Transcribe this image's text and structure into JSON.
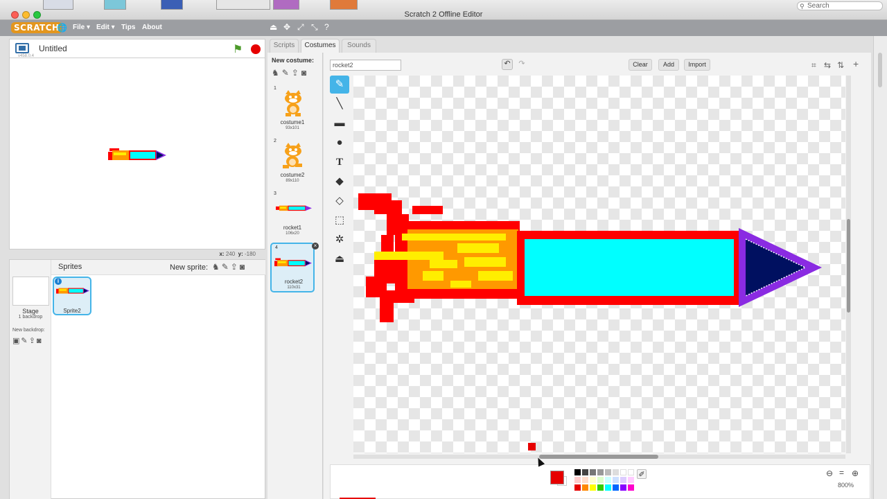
{
  "window": {
    "title": "Scratch 2 Offline Editor"
  },
  "mac": {
    "search_placeholder": "Search"
  },
  "menubar": {
    "logo": "SCRATCH",
    "file": "File ▾",
    "edit": "Edit ▾",
    "tips": "Tips",
    "about": "About"
  },
  "stage": {
    "title": "Untitled",
    "version": "v458.0.4",
    "coord_x_label": "x:",
    "coord_x": "240",
    "coord_y_label": "y:",
    "coord_y": "-180"
  },
  "sprites_panel": {
    "title": "Sprites",
    "new_sprite_label": "New sprite:",
    "stage_label": "Stage",
    "stage_sub": "1 backdrop",
    "new_backdrop_label": "New backdrop:",
    "sprites": [
      {
        "name": "Sprite2"
      }
    ]
  },
  "tabs": [
    {
      "label": "Scripts"
    },
    {
      "label": "Costumes"
    },
    {
      "label": "Sounds"
    }
  ],
  "costumes": {
    "new_costume_label": "New costume:",
    "items": [
      {
        "num": "1",
        "name": "costume1",
        "size": "93x101"
      },
      {
        "num": "2",
        "name": "costume2",
        "size": "89x110"
      },
      {
        "num": "3",
        "name": "rocket1",
        "size": "106x20"
      },
      {
        "num": "4",
        "name": "rocket2",
        "size": "110x31"
      }
    ]
  },
  "paint_editor": {
    "costume_name": "rocket2",
    "clear_label": "Clear",
    "add_label": "Add",
    "import_label": "Import",
    "zoom_level": "800%"
  },
  "colors": {
    "primary": "#e60000",
    "secondary": "#ffffff",
    "rocket_body": "#00ffff",
    "rocket_frame": "#ff0000",
    "rocket_nose": "#001060",
    "rocket_nose_outline": "#8a2be2",
    "flame_orange": "#ff9900",
    "flame_yellow": "#ffee00",
    "selection_blue": "#44b4e8"
  },
  "swatch_colors": [
    "#000000",
    "#444444",
    "#777777",
    "#999999",
    "#bbbbbb",
    "#dddddd",
    "#ffffff",
    "#ffffff",
    "#ffcccc",
    "#ffddcc",
    "#ffffcc",
    "#ddffcc",
    "#ccffff",
    "#cce0ff",
    "#ddccff",
    "#ffccff",
    "#e60000",
    "#ff8800",
    "#ffff00",
    "#33cc00",
    "#00ffff",
    "#0066ff",
    "#8800ff",
    "#ff00cc"
  ]
}
